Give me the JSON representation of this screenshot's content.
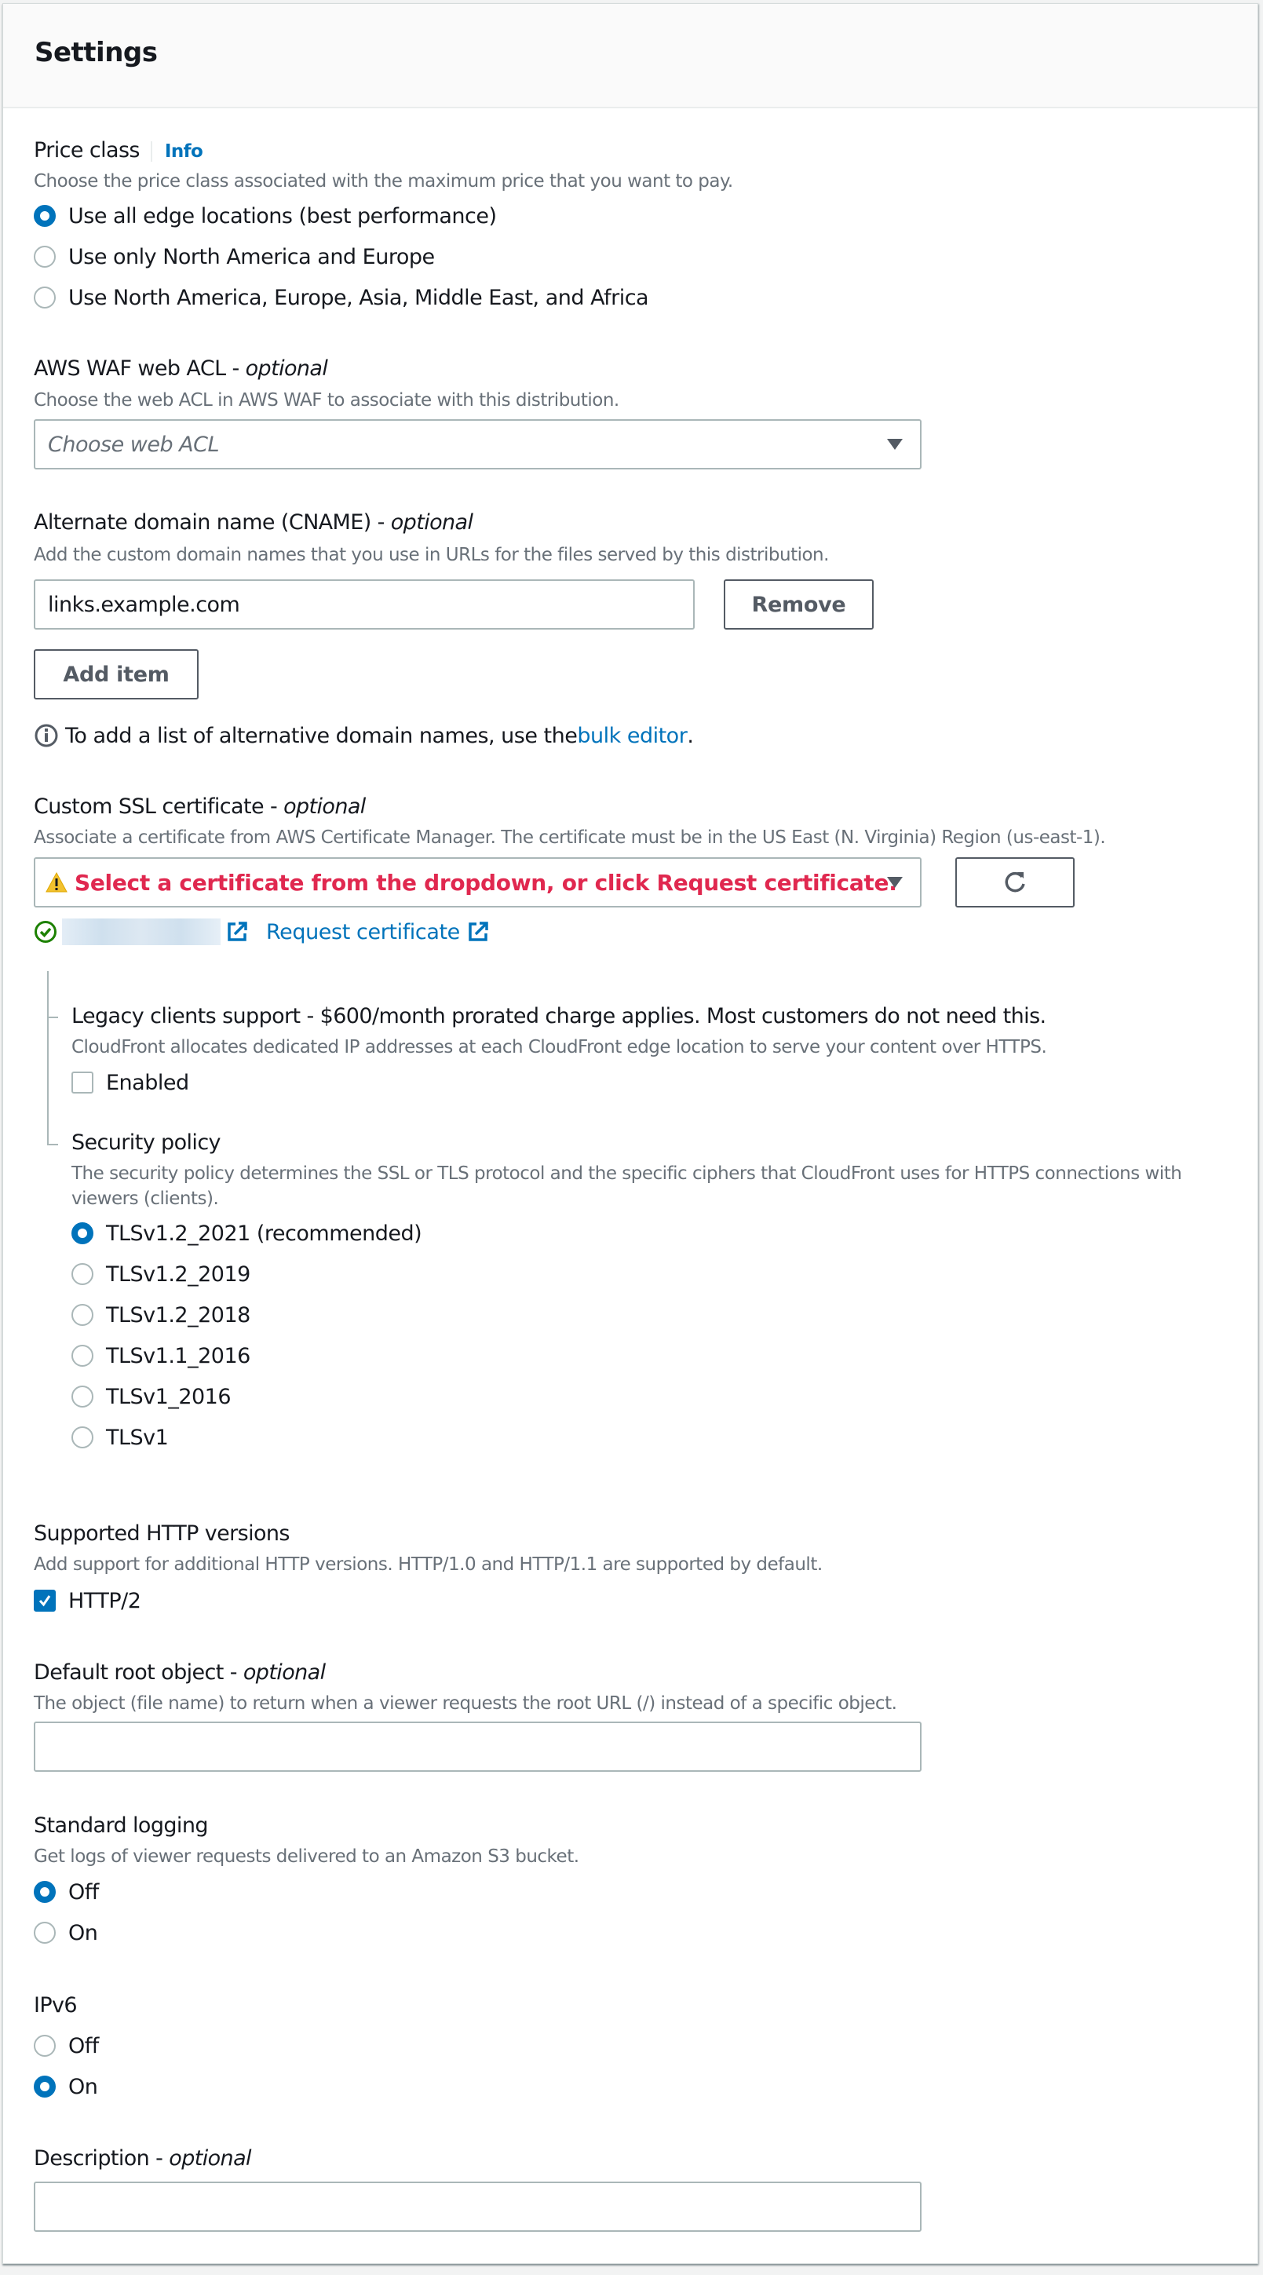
{
  "section": {
    "title": "Settings"
  },
  "price_class": {
    "label": "Price class",
    "info": "Info",
    "description": "Choose the price class associated with the maximum price that you want to pay.",
    "options": [
      {
        "label": "Use all edge locations (best performance)",
        "checked": true
      },
      {
        "label": "Use only North America and Europe",
        "checked": false
      },
      {
        "label": "Use North America, Europe, Asia, Middle East, and Africa",
        "checked": false
      }
    ]
  },
  "waf": {
    "label": "AWS WAF web ACL - ",
    "optional": "optional",
    "description": "Choose the web ACL in AWS WAF to associate with this distribution.",
    "placeholder": "Choose web ACL"
  },
  "cname": {
    "label": "Alternate domain name (CNAME) - ",
    "optional": "optional",
    "description": "Add the custom domain names that you use in URLs for the files served by this distribution.",
    "value": "links.example.com",
    "remove_label": "Remove",
    "add_label": "Add item",
    "hint_prefix": "To add a list of alternative domain names, use the ",
    "hint_link": "bulk editor",
    "hint_suffix": "."
  },
  "ssl": {
    "label": "Custom SSL certificate - ",
    "optional": "optional",
    "description": "Associate a certificate from AWS Certificate Manager. The certificate must be in the US East (N. Virginia) Region (us-east-1).",
    "warning": "Select a certificate from the dropdown, or click Request certificate.",
    "request_label": "Request certificate",
    "status_color": "#1d8102",
    "warning_color": "#e0284f"
  },
  "legacy": {
    "label": "Legacy clients support - $600/month prorated charge applies. Most customers do not need this.",
    "description": "CloudFront allocates dedicated IP addresses at each CloudFront edge location to serve your content over HTTPS.",
    "checkbox_label": "Enabled",
    "checked": false
  },
  "security_policy": {
    "label": "Security policy",
    "description": "The security policy determines the SSL or TLS protocol and the specific ciphers that CloudFront uses for HTTPS connections with viewers (clients).",
    "options": [
      {
        "label": "TLSv1.2_2021 (recommended)",
        "checked": true
      },
      {
        "label": "TLSv1.2_2019",
        "checked": false
      },
      {
        "label": "TLSv1.2_2018",
        "checked": false
      },
      {
        "label": "TLSv1.1_2016",
        "checked": false
      },
      {
        "label": "TLSv1_2016",
        "checked": false
      },
      {
        "label": "TLSv1",
        "checked": false
      }
    ]
  },
  "http_versions": {
    "label": "Supported HTTP versions",
    "description": "Add support for additional HTTP versions. HTTP/1.0 and HTTP/1.1 are supported by default.",
    "checkbox_label": "HTTP/2",
    "checked": true
  },
  "root_object": {
    "label": "Default root object - ",
    "optional": "optional",
    "description": "The object (file name) to return when a viewer requests the root URL (/) instead of a specific object.",
    "value": ""
  },
  "logging": {
    "label": "Standard logging",
    "description": "Get logs of viewer requests delivered to an Amazon S3 bucket.",
    "options": [
      {
        "label": "Off",
        "checked": true
      },
      {
        "label": "On",
        "checked": false
      }
    ]
  },
  "ipv6": {
    "label": "IPv6",
    "options": [
      {
        "label": "Off",
        "checked": false
      },
      {
        "label": "On",
        "checked": true
      }
    ]
  },
  "description_field": {
    "label": "Description - ",
    "optional": "optional",
    "value": ""
  },
  "colors": {
    "accent": "#0073bb",
    "text": "#16191f",
    "muted": "#687078",
    "border": "#aab7b8"
  }
}
